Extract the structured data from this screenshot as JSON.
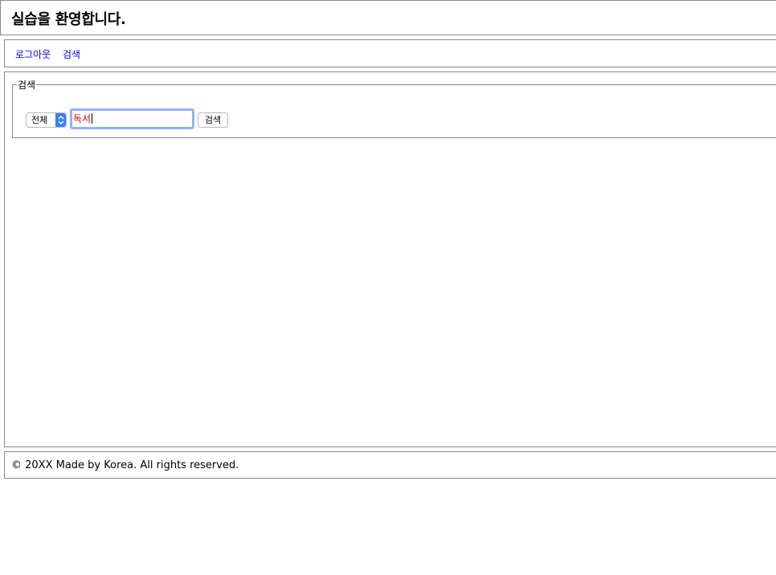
{
  "header": {
    "title": "실습을 환영합니다."
  },
  "nav": {
    "logout": "로그아웃",
    "search": "검색"
  },
  "search_form": {
    "legend": "검색",
    "select_value": "전체",
    "input_value": "독서",
    "submit_label": "검색"
  },
  "footer": {
    "copyright": "© 20XX Made by Korea. All rights reserved."
  },
  "colors": {
    "link": "#0000ee",
    "input_text": "#d00000",
    "focus_ring": "#8db4f5",
    "select_arrow_bg": "#3b82f6"
  }
}
